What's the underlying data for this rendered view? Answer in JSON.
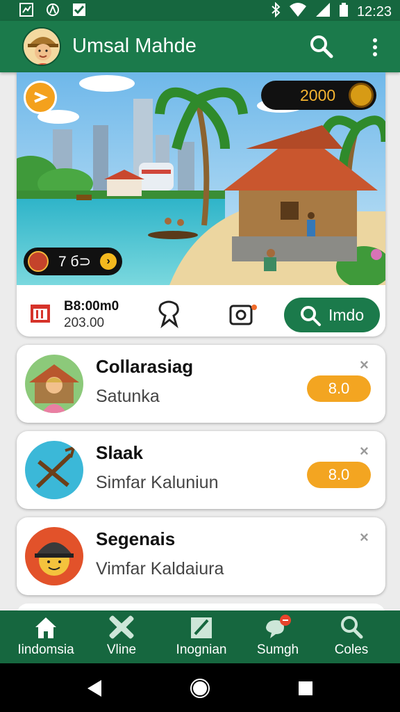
{
  "status_bar": {
    "time": "12:23",
    "left_icons": [
      "chart-icon",
      "compass-icon",
      "checkbox-icon"
    ],
    "right_icons": [
      "bluetooth-icon",
      "wifi-icon",
      "signal-icon",
      "battery-icon"
    ]
  },
  "app_bar": {
    "title": "Umsal Mahde",
    "actions": [
      "search-icon",
      "more-vert-icon"
    ]
  },
  "hero": {
    "coins": "2000",
    "ticket": "7 б⊃",
    "stat_value": "B8:00m0",
    "stat_sub": "203.00",
    "find_button": "Imdo",
    "colors": {
      "accent": "#1b7a4b",
      "coin": "#d79b15"
    }
  },
  "cards": [
    {
      "title": "Collarasiag",
      "subtitle": "Satunka",
      "badge": "8.0",
      "close": "×"
    },
    {
      "title": "Slaak",
      "subtitle": "Simfar Kaluniun",
      "badge": "8.0",
      "close": "×"
    },
    {
      "title": "Segenais",
      "subtitle": "Vimfar Kaldaiura",
      "close": "×"
    }
  ],
  "bottom_nav": [
    {
      "label": "Iindomsia",
      "icon": "home-icon"
    },
    {
      "label": "Vline",
      "icon": "cross-icon"
    },
    {
      "label": "Inognian",
      "icon": "edit-icon"
    },
    {
      "label": "Sumgh",
      "icon": "chat-icon"
    },
    {
      "label": "Coles",
      "icon": "search-icon"
    }
  ],
  "system_nav": [
    "back-icon",
    "home-circle-icon",
    "recents-icon"
  ]
}
